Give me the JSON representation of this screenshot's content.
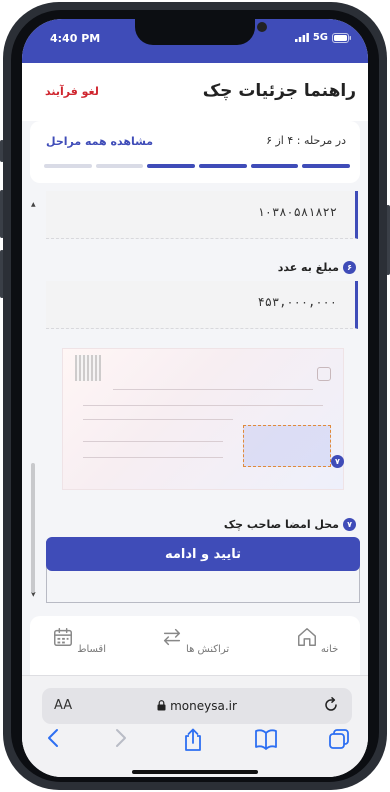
{
  "status_bar": {
    "time": "4:40 PM",
    "network": "5G"
  },
  "header": {
    "title": "راهنما جزئیات چک",
    "cancel_label": "لغو فرآیند"
  },
  "steps": {
    "text": "در مرحله : ۴ از ۶",
    "view_all_label": "مشاهده همه مراحل",
    "completed": 4,
    "total": 6,
    "colors": {
      "done": "#3f4cb8",
      "pending": "#d9dbe6"
    }
  },
  "fields": {
    "account_number": "۱۰۳۸۰۵۸۱۸۲۲",
    "amount_label": "مبلغ به عدد",
    "amount_badge": "۶",
    "amount_value": "۴۵۳,۰۰۰,۰۰۰",
    "signature_label": "محل امضا صاحب چک",
    "signature_badge": "۷",
    "cheque_badge": "۷"
  },
  "actions": {
    "confirm_label": "تایید و ادامه"
  },
  "bottom_nav": {
    "items": [
      {
        "label": "خانه",
        "icon": "home-icon"
      },
      {
        "label": "تراکنش ها",
        "icon": "transactions-icon"
      },
      {
        "label": "اقساط",
        "icon": "installments-icon"
      }
    ]
  },
  "browser": {
    "text_size_label": "AA",
    "url": "moneysa.ir"
  },
  "colors": {
    "primary": "#3f4cb8",
    "danger": "#d0262f"
  }
}
